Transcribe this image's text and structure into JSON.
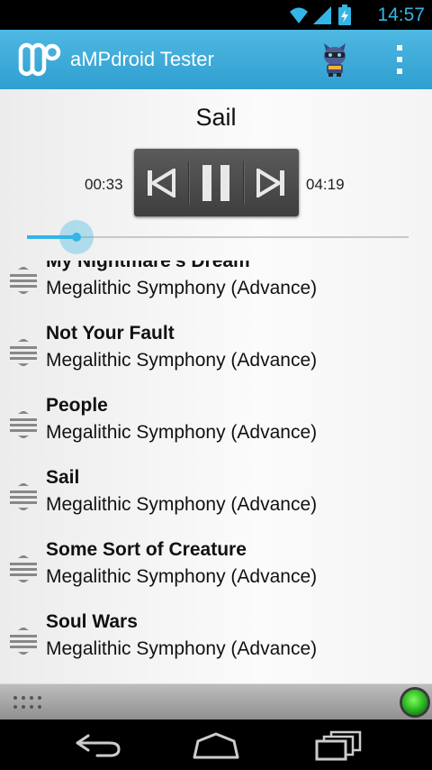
{
  "status_bar": {
    "time": "14:57"
  },
  "action_bar": {
    "title": "aMPdroid Tester"
  },
  "player": {
    "now_playing": "Sail",
    "elapsed": "00:33",
    "total": "04:19",
    "progress": 0.13
  },
  "playlist": [
    {
      "title": "My Nightmare's Dream",
      "album": "Megalithic Symphony (Advance)"
    },
    {
      "title": "Not Your Fault",
      "album": "Megalithic Symphony (Advance)"
    },
    {
      "title": "People",
      "album": "Megalithic Symphony (Advance)"
    },
    {
      "title": "Sail",
      "album": "Megalithic Symphony (Advance)"
    },
    {
      "title": "Some Sort of Creature",
      "album": "Megalithic Symphony (Advance)"
    },
    {
      "title": "Soul Wars",
      "album": "Megalithic Symphony (Advance)"
    }
  ],
  "icons": {
    "status": [
      "wifi-icon",
      "signal-icon",
      "battery-charging-icon"
    ],
    "player": [
      "previous-icon",
      "pause-icon",
      "next-icon"
    ],
    "nav": [
      "back-icon",
      "home-icon",
      "recent-apps-icon"
    ]
  },
  "colors": {
    "accent": "#33b5e5",
    "action_bar": "#3aa8d8",
    "connection_led": "#3ddc2e"
  }
}
